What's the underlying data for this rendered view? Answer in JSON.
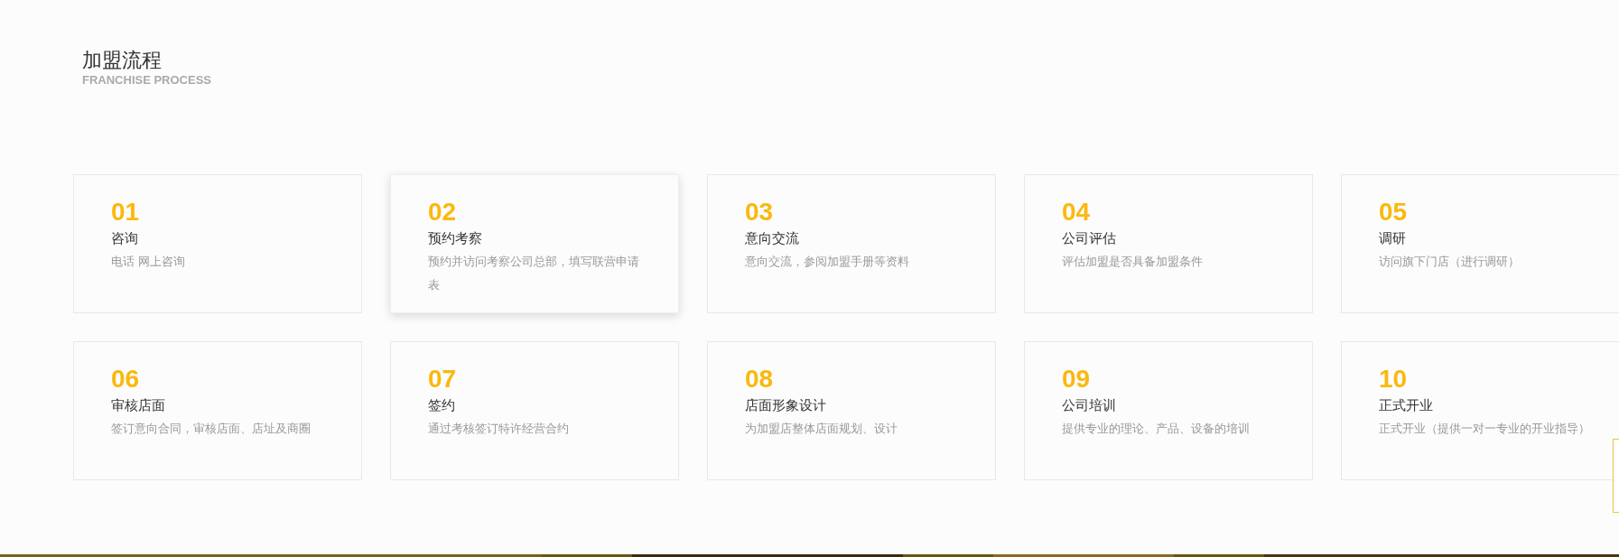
{
  "section": {
    "title": "加盟流程",
    "subtitle": "FRANCHISE PROCESS"
  },
  "steps": [
    {
      "number": "01",
      "title": "咨询",
      "description": "电话 网上咨询",
      "raised": false
    },
    {
      "number": "02",
      "title": "预约考察",
      "description": "预约并访问考察公司总部，填写联营申请表",
      "raised": true
    },
    {
      "number": "03",
      "title": "意向交流",
      "description": "意向交流，参阅加盟手册等资料",
      "raised": false
    },
    {
      "number": "04",
      "title": "公司评估",
      "description": "评估加盟是否具备加盟条件",
      "raised": false
    },
    {
      "number": "05",
      "title": "调研",
      "description": "访问旗下门店（进行调研）",
      "raised": false
    },
    {
      "number": "06",
      "title": "审核店面",
      "description": "签订意向合同，审核店面、店址及商圈",
      "raised": false
    },
    {
      "number": "07",
      "title": "签约",
      "description": "通过考核签订特许经营合约",
      "raised": false
    },
    {
      "number": "08",
      "title": "店面形象设计",
      "description": "为加盟店整体店面规划、设计",
      "raised": false
    },
    {
      "number": "09",
      "title": "公司培训",
      "description": "提供专业的理论、产品、设备的培训",
      "raised": false
    },
    {
      "number": "10",
      "title": "正式开业",
      "description": "正式开业（提供一对一专业的开业指导）",
      "raised": false
    }
  ]
}
